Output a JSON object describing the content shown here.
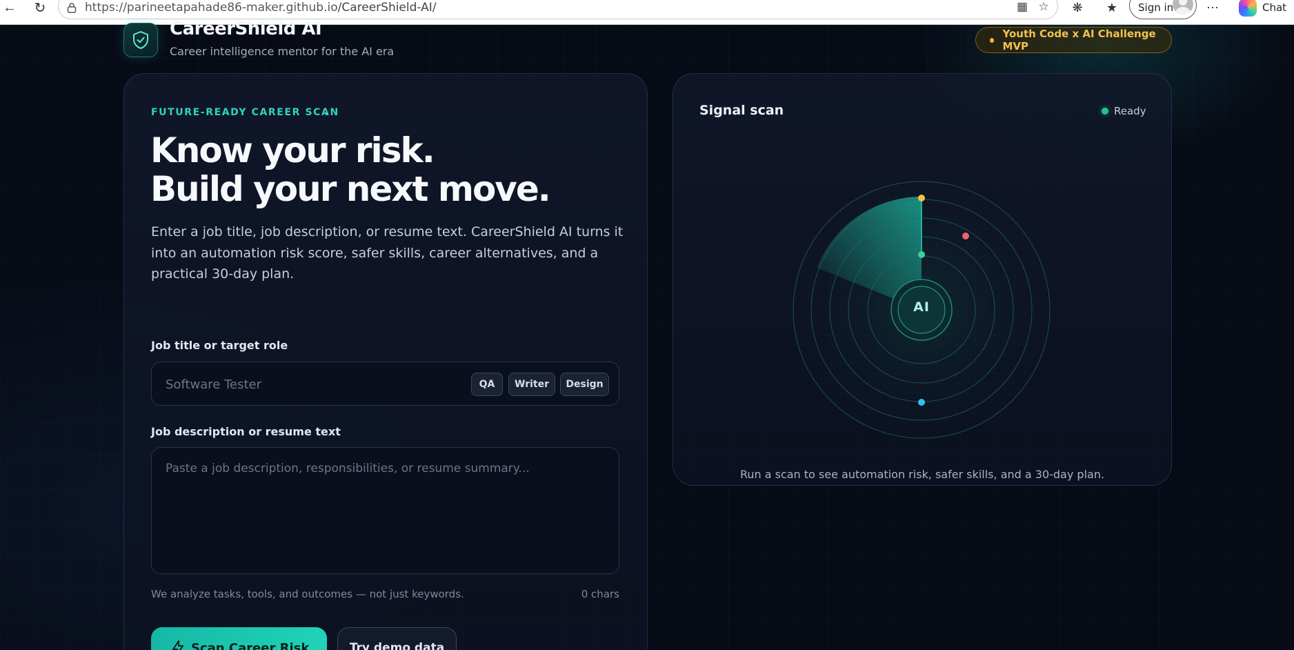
{
  "browser": {
    "url_host": "https://parineetapahade86-maker.github.io",
    "url_path": "/CareerShield-AI/",
    "sign_in_label": "Sign in",
    "chat_label": "Chat"
  },
  "header": {
    "title": "CareerShield AI",
    "subtitle": "Career intelligence mentor for the AI era",
    "badge": "Youth Code x AI Challenge MVP"
  },
  "scan_form": {
    "eyebrow": "FUTURE-READY CAREER SCAN",
    "headline_line1": "Know your risk.",
    "headline_line2": "Build your next move.",
    "intro": "Enter a job title, job description, or resume text. CareerShield AI turns it into an automation risk score, safer skills, career alternatives, and a practical 30-day plan.",
    "job_title_label": "Job title or target role",
    "job_title_placeholder": "Software Tester",
    "job_title_value": "",
    "quick_chips": [
      "QA",
      "Writer",
      "Design"
    ],
    "description_label": "Job description or resume text",
    "description_placeholder": "Paste a job description, responsibilities, or resume summary...",
    "description_value": "",
    "helper_text": "We analyze tasks, tools, and outcomes — not just keywords.",
    "char_count": "0 chars",
    "scan_button": "Scan Career Risk",
    "demo_button": "Try demo data"
  },
  "signal_panel": {
    "title": "Signal scan",
    "status": "Ready",
    "center_label": "AI",
    "footer": "Run a scan to see automation risk, safer skills, and a 30-day plan."
  },
  "colors": {
    "accent": "#2dd4bf",
    "badge": "#f2c14e",
    "status_ready": "#22c58b",
    "dot_yellow": "#f6c23e",
    "dot_red": "#f0626a",
    "dot_green": "#34d399",
    "dot_blue": "#38bdf8"
  }
}
